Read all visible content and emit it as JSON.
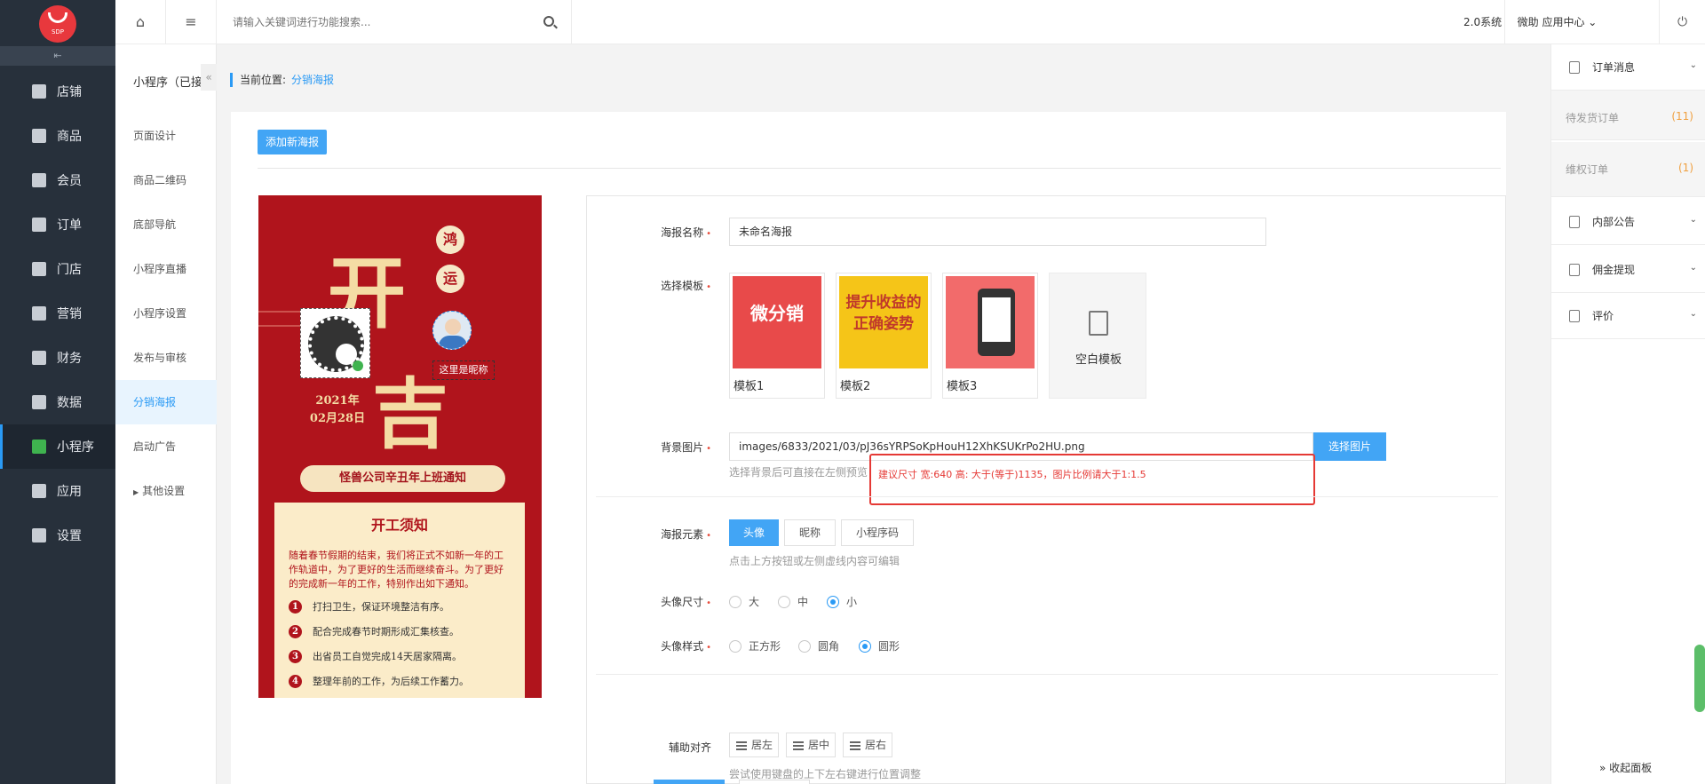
{
  "app": {
    "logo_text": "SDP"
  },
  "sidebar": {
    "items": [
      {
        "label": "店铺",
        "icon": "store-icon"
      },
      {
        "label": "商品",
        "icon": "goods-icon"
      },
      {
        "label": "会员",
        "icon": "member-icon"
      },
      {
        "label": "订单",
        "icon": "order-icon"
      },
      {
        "label": "门店",
        "icon": "shop-icon"
      },
      {
        "label": "营销",
        "icon": "marketing-icon"
      },
      {
        "label": "财务",
        "icon": "finance-icon"
      },
      {
        "label": "数据",
        "icon": "data-icon"
      },
      {
        "label": "小程序",
        "icon": "miniprogram-icon",
        "active": true
      },
      {
        "label": "应用",
        "icon": "apps-icon"
      },
      {
        "label": "设置",
        "icon": "settings-icon"
      }
    ]
  },
  "subnav": {
    "title": "小程序（已接",
    "items": [
      "页面设计",
      "商品二维码",
      "底部导航",
      "小程序直播",
      "小程序设置",
      "发布与审核",
      "分销海报",
      "启动广告",
      "其他设置"
    ],
    "active_index": 6
  },
  "topbar": {
    "search_placeholder": "请输入关键词进行功能搜索...",
    "system_version": "2.0系统",
    "app_center": "微助 应用中心"
  },
  "breadcrumb": {
    "prefix": "当前位置:",
    "current": "分销海报"
  },
  "toolbar": {
    "add_poster": "添加新海报"
  },
  "poster_preview": {
    "big_char_1": "开",
    "big_char_2": "吉",
    "badge_1": "鸿",
    "badge_2": "运",
    "year": "2021年",
    "date": "02月28日",
    "nickname_placeholder": "这里是昵称",
    "notice": "怪兽公司辛丑年上班通知",
    "card_title": "开工须知",
    "card_text": "随着春节假期的结束，我们将正式不如新一年的工作轨道中，为了更好的生活而继续奋斗。为了更好的完成新一年的工作，特别作出如下通知。",
    "rules": [
      {
        "n": "1",
        "text": "打扫卫生，保证环境整洁有序。"
      },
      {
        "n": "2",
        "text": "配合完成春节时期形成汇集核查。"
      },
      {
        "n": "3",
        "text": "出省员工自觉完成14天居家隔离。"
      },
      {
        "n": "4",
        "text": "整理年前的工作，为后续工作蓄力。"
      }
    ]
  },
  "form": {
    "name_label": "海报名称",
    "name_value": "未命名海报",
    "template_label": "选择模板",
    "templates": [
      {
        "caption": "模板1",
        "art": "微分销"
      },
      {
        "caption": "模板2",
        "art": "提升收益的正确姿势"
      },
      {
        "caption": "模板3",
        "art": ""
      }
    ],
    "blank_template": "空白模板",
    "bg_label": "背景图片",
    "bg_value": "images/6833/2021/03/pJ36sYRPSoKpHouH12XhKSUKrPo2HU.png",
    "bg_button": "选择图片",
    "bg_hint": "选择背景后可直接在左侧预览",
    "bg_warning": "建议尺寸 宽:640 高: 大于(等于)1135，图片比例请大于1:1.5",
    "elements_label": "海报元素",
    "elements": [
      "头像",
      "昵称",
      "小程序码"
    ],
    "elements_hint": "点击上方按钮或左侧虚线内容可编辑",
    "avatar_size_label": "头像尺寸",
    "avatar_sizes": [
      "大",
      "中",
      "小"
    ],
    "avatar_size_selected": "小",
    "avatar_style_label": "头像样式",
    "avatar_styles": [
      "正方形",
      "圆角",
      "圆形"
    ],
    "avatar_style_selected": "圆形",
    "align_label": "辅助对齐",
    "aligns": [
      "居左",
      "居中",
      "居右"
    ],
    "align_hint": "尝试使用键盘的上下左右键进行位置调整"
  },
  "right_panel": {
    "sections": [
      {
        "label": "订单消息"
      },
      {
        "label": "内部公告"
      },
      {
        "label": "佣金提现"
      },
      {
        "label": "评价"
      }
    ],
    "order_items": [
      {
        "label": "待发货订单",
        "count": "(11)"
      },
      {
        "label": "维权订单",
        "count": "(1)"
      }
    ],
    "fold_label": "» 收起面板"
  },
  "colors": {
    "accent": "#42a5f5",
    "sidebar_bg": "#27303b",
    "warning": "#e53935",
    "poster_red": "#b0141c"
  }
}
